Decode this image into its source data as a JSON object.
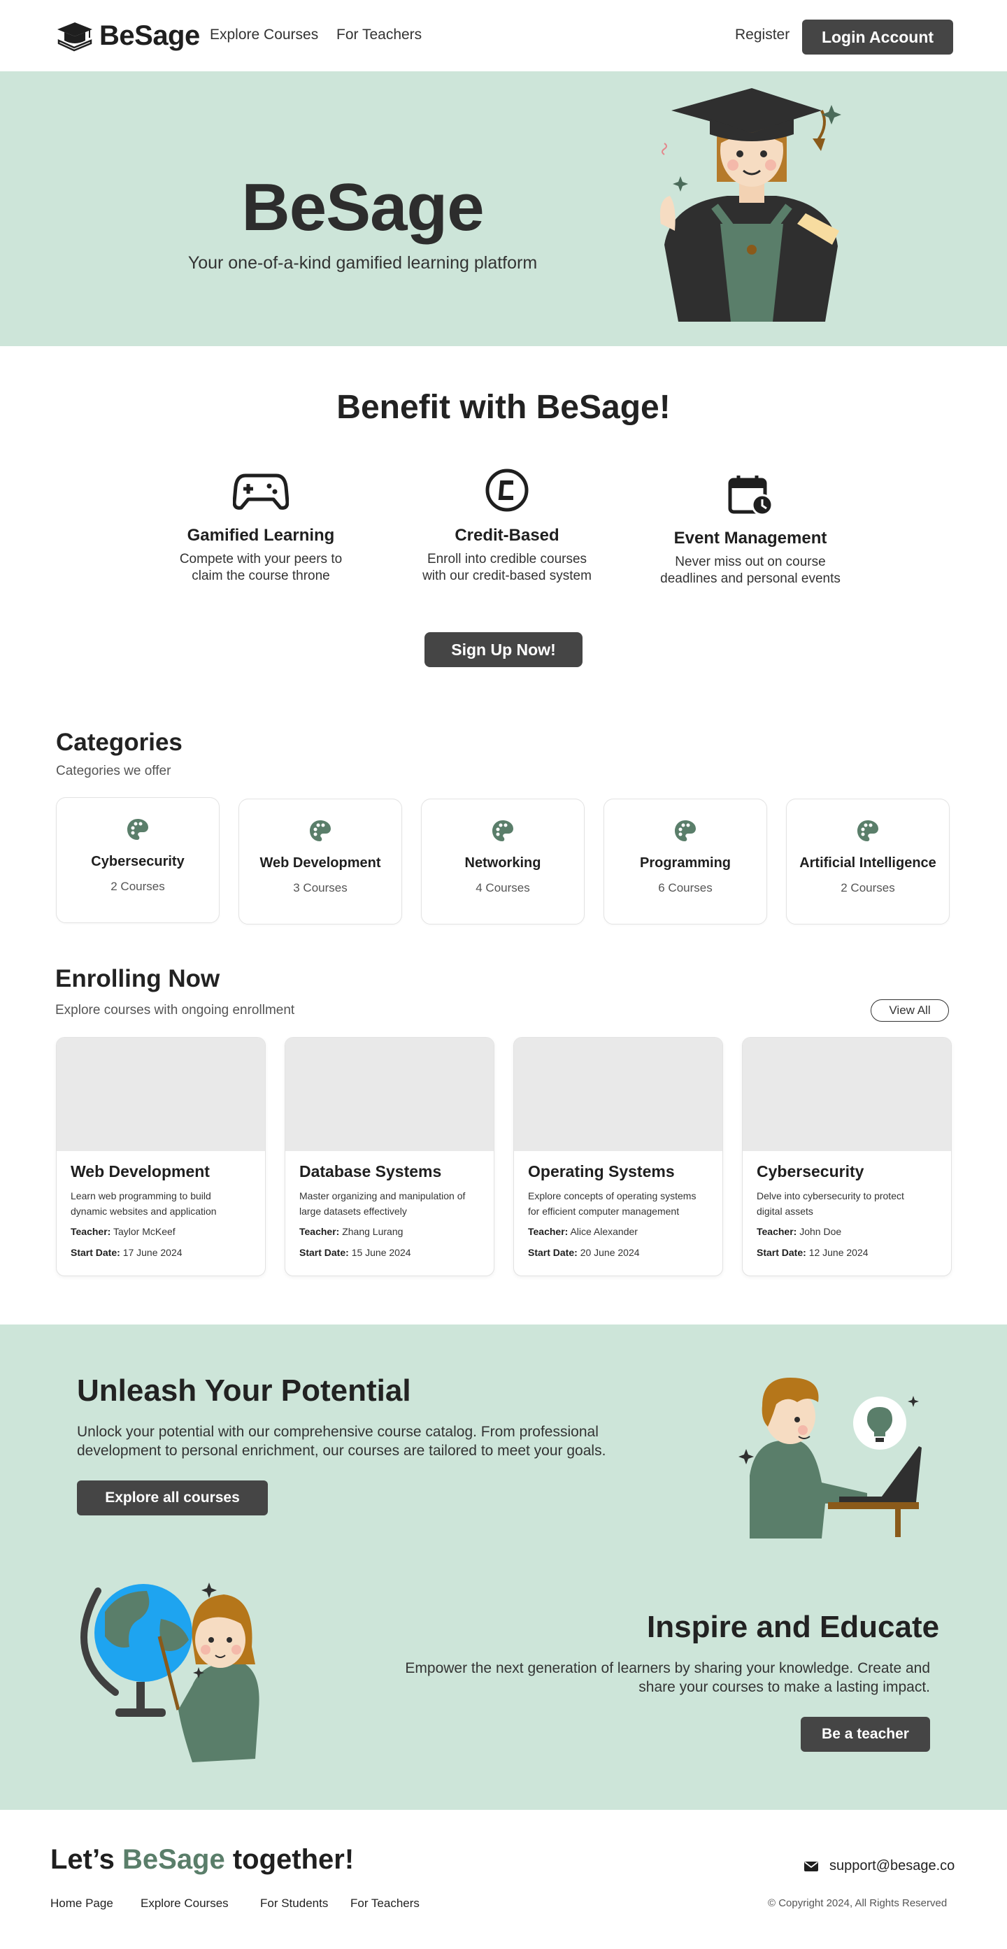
{
  "nav": {
    "brand": "BeSage",
    "links": [
      "Explore Courses",
      "For Teachers"
    ],
    "register": "Register",
    "login": "Login Account"
  },
  "hero": {
    "title": "BeSage",
    "subtitle": "Your one-of-a-kind gamified learning platform"
  },
  "benefits": {
    "title": "Benefit with BeSage!",
    "items": [
      {
        "icon": "gamepad-icon",
        "title": "Gamified Learning",
        "line1": "Compete with your peers to",
        "line2": "claim the course throne"
      },
      {
        "icon": "credit-coin-icon",
        "title": "Credit-Based",
        "line1": "Enroll into credible courses",
        "line2": "with our credit-based system"
      },
      {
        "icon": "calendar-clock-icon",
        "title": "Event Management",
        "line1": "Never miss out on course",
        "line2": "deadlines and personal events"
      }
    ],
    "cta": "Sign Up Now!"
  },
  "categories": {
    "title": "Categories",
    "subtitle": "Categories we offer",
    "items": [
      {
        "name": "Cybersecurity",
        "count": "2 Courses"
      },
      {
        "name": "Web Development",
        "count": "3 Courses"
      },
      {
        "name": "Networking",
        "count": "4 Courses"
      },
      {
        "name": "Programming",
        "count": "6 Courses"
      },
      {
        "name": "Artificial Intelligence",
        "count": "2 Courses"
      }
    ]
  },
  "enrolling": {
    "title": "Enrolling Now",
    "subtitle": "Explore courses with ongoing enrollment",
    "view_all": "View All",
    "teacher_label": "Teacher:",
    "start_label": "Start Date:",
    "courses": [
      {
        "title": "Web Development",
        "desc1": "Learn web programming to build",
        "desc2": "dynamic websites and application",
        "teacher": "Taylor McKeef",
        "start": "17 June 2024"
      },
      {
        "title": "Database Systems",
        "desc1": "Master organizing and manipulation of",
        "desc2": "large datasets effectively",
        "teacher": "Zhang Lurang",
        "start": "15 June 2024"
      },
      {
        "title": "Operating Systems",
        "desc1": "Explore concepts of operating systems",
        "desc2": "for efficient computer management",
        "teacher": "Alice Alexander",
        "start": "20 June 2024"
      },
      {
        "title": "Cybersecurity",
        "desc1": "Delve into cybersecurity to protect",
        "desc2": "digital assets",
        "teacher": "John Doe",
        "start": "12 June 2024"
      }
    ]
  },
  "potential": {
    "title": "Unleash Your Potential",
    "line1": "Unlock your potential with our comprehensive course catalog. From professional",
    "line2": "development to personal enrichment, our courses are tailored to meet your goals.",
    "cta": "Explore all courses"
  },
  "inspire": {
    "title": "Inspire and Educate",
    "line1": "Empower the next generation of learners by sharing your knowledge. Create and",
    "line2": "share your courses to make a lasting impact.",
    "cta": "Be a teacher"
  },
  "footer": {
    "heading_pre": "Let’s ",
    "heading_accent": "BeSage",
    "heading_post": " together!",
    "email": "support@besage.co",
    "links": [
      "Home Page",
      "Explore Courses",
      "For Students",
      "For Teachers"
    ],
    "copyright": "© Copyright 2024, All Rights Reserved"
  },
  "colors": {
    "accent": "#5a7e6a",
    "mint": "#cde5d9",
    "dark_button": "#454545"
  }
}
